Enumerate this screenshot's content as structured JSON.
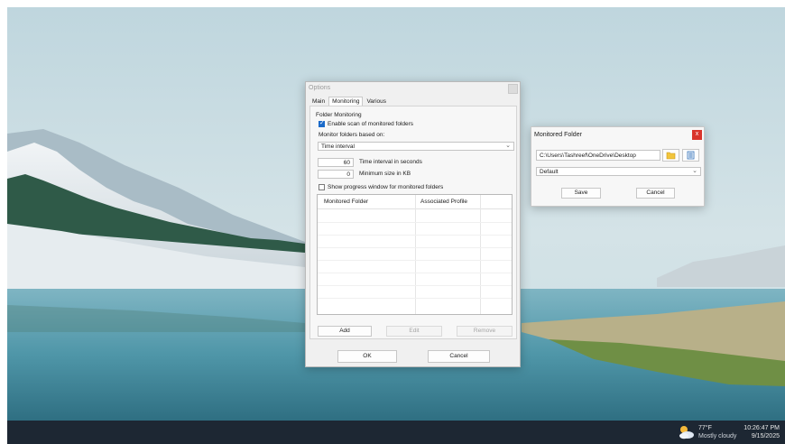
{
  "options_dialog": {
    "title": "Options",
    "tabs": [
      {
        "label": "Main"
      },
      {
        "label": "Monitoring"
      },
      {
        "label": "Various"
      }
    ],
    "group_label": "Folder Monitoring",
    "enable_scan_label": "Enable scan of monitored folders",
    "enable_scan_checked": true,
    "monitor_based_label": "Monitor folders based on:",
    "monitor_based_value": "Time interval",
    "time_interval_value": "60",
    "time_interval_label": "Time interval in seconds",
    "min_size_value": "0",
    "min_size_label": "Minimum size in KB",
    "show_progress_label": "Show progress window for monitored folders",
    "show_progress_checked": false,
    "list_columns": [
      "Monitored Folder",
      "Associated Profile"
    ],
    "add_label": "Add",
    "edit_label": "Edit",
    "remove_label": "Remove",
    "ok_label": "OK",
    "cancel_label": "Cancel"
  },
  "monitored_folder_dialog": {
    "title": "Monitored Folder",
    "close_glyph": "x",
    "path_value": "C:\\Users\\Tashreef\\OneDrive\\Desktop",
    "profile_value": "Default",
    "save_label": "Save",
    "cancel_label": "Cancel"
  },
  "taskbar": {
    "temperature": "77°F",
    "condition": "Mostly cloudy",
    "time": "10:26:47 PM",
    "date": "9/15/2025"
  },
  "colors": {
    "accent": "#1b6ac9",
    "close_red": "#d9342b",
    "taskbar": "#1d2733"
  },
  "icons": [
    "folder-icon",
    "profile-icon",
    "weather-icon",
    "chevron-down-icon",
    "close-icon",
    "check-icon"
  ]
}
